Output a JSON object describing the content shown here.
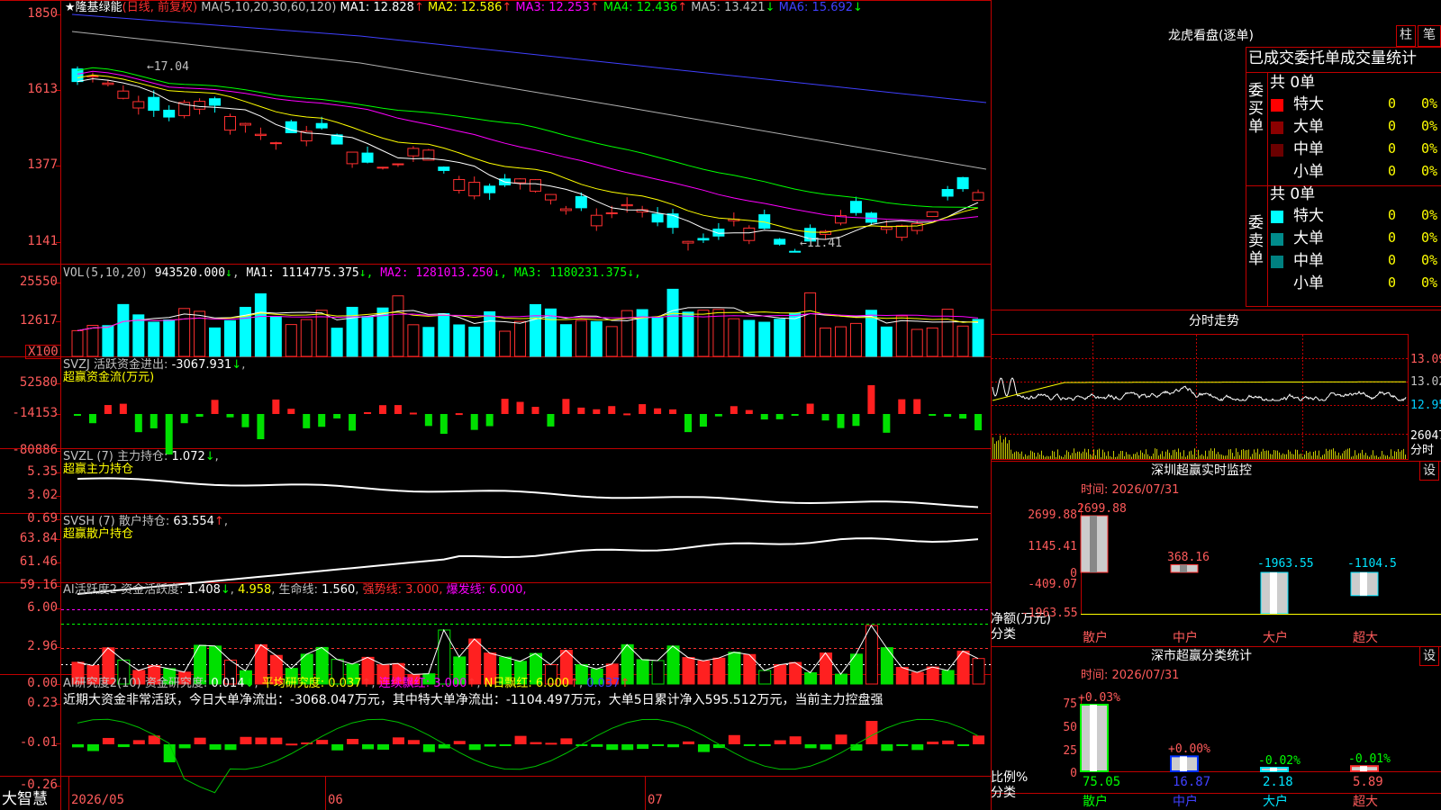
{
  "app_name": "大智慧",
  "main": {
    "star": "★",
    "stock_name": "隆基绿能",
    "period": "(日线, 前复权)",
    "ma_label": "MA(5,10,20,30,60,120)",
    "ma": [
      {
        "name": "MA1",
        "value": "12.828",
        "arrow": "↑",
        "color": "#ffffff"
      },
      {
        "name": "MA2",
        "value": "12.586",
        "arrow": "↑",
        "color": "#ffff00"
      },
      {
        "name": "MA3",
        "value": "12.253",
        "arrow": "↑",
        "color": "#ff00ff"
      },
      {
        "name": "MA4",
        "value": "12.436",
        "arrow": "↑",
        "color": "#00ff00"
      },
      {
        "name": "MA5",
        "value": "13.421",
        "arrow": "↓",
        "color": "#c0c0c0"
      },
      {
        "name": "MA6",
        "value": "15.692",
        "arrow": "↓",
        "color": "#4040ff"
      }
    ],
    "y_ticks": [
      "1850",
      "1613",
      "1377",
      "1141"
    ],
    "high_note": "←17.04",
    "low_note": "←11.41"
  },
  "vol": {
    "label": "VOL(5,10,20)",
    "value": "943520.000",
    "ma": [
      {
        "name": "MA1",
        "value": "1114775.375",
        "arrow": "↓",
        "color": "#ffffff"
      },
      {
        "name": "MA2",
        "value": "1281013.250",
        "arrow": "↓",
        "color": "#ff00ff"
      },
      {
        "name": "MA3",
        "value": "1180231.375",
        "arrow": "↓",
        "color": "#00ff00"
      }
    ],
    "y_ticks": [
      "25550",
      "12617"
    ],
    "unit": "X100"
  },
  "svzj": {
    "label": "SVZJ",
    "title": "活跃资金进出",
    "value": "-3067.931",
    "arrow": "↓",
    "subtitle": "超赢资金流(万元)",
    "y_ticks": [
      "52580",
      "-14153",
      "-80886"
    ]
  },
  "svzl": {
    "label": "SVZL (7)",
    "title": "主力持仓",
    "value": "1.072",
    "arrow": "↓",
    "subtitle": "超赢主力持仓",
    "y_ticks": [
      "5.35",
      "3.02",
      "0.69"
    ]
  },
  "svsh": {
    "label": "SVSH (7)",
    "title": "散户持仓",
    "value": "63.554",
    "arrow": "↑",
    "subtitle": "超赢散户持仓",
    "y_ticks": [
      "63.84",
      "61.46",
      "59.16"
    ]
  },
  "ai1": {
    "label": "AI活跃度2",
    "title": "资金活跃度",
    "value": "1.408",
    "arrow": "↓",
    "value2": "4.958",
    "life_label": "生命线",
    "life_value": "1.560",
    "strong_label": "强势线",
    "strong_value": "3.000",
    "burst_label": "爆发线",
    "burst_value": "6.000",
    "y_ticks": [
      "6.00",
      "2.96",
      "0.00"
    ]
  },
  "ai2": {
    "label": "AI研究度2(10)",
    "title": "资金研究度",
    "value": "0.014",
    "arrow": "↓",
    "avg_label": "平均研究度",
    "avg_value": "0.037",
    "cont_label": "连续飘红",
    "cont_value": "3.000",
    "n_label": "N日飘红",
    "n_value": "6.000",
    "extra_value": "0.037",
    "comment": "近期大资金非常活跃，今日大单净流出：-3068.047万元，其中特大单净流出：-1104.497万元，大单5日累计净入595.512万元，当前主力控盘强",
    "y_ticks": [
      "0.23",
      "-0.01",
      "-0.26"
    ]
  },
  "x_axis": [
    "2026/05",
    "06",
    "07"
  ],
  "dragon": {
    "title": "龙虎看盘(逐单)",
    "btn1": "柱",
    "btn2": "笔",
    "subtitle": "已成交委托单成交量统计",
    "buy_label": "委买单",
    "sell_label": "委卖单",
    "buy_total": "共 0单",
    "sell_total": "共 0单",
    "rows": [
      "特大",
      "大单",
      "中单",
      "小单"
    ],
    "buy_colors": [
      "#ff0000",
      "#8b0000",
      "#6b0000",
      ""
    ],
    "sell_colors": [
      "#00ffff",
      "#008b8b",
      "#008080",
      ""
    ],
    "count": "0",
    "pct": "0%"
  },
  "intraday": {
    "title": "分时走势",
    "price_ticks": [
      "13.09",
      "13.02",
      "12.95"
    ],
    "vol_value": "26047",
    "vol_label": "分时"
  },
  "monitor": {
    "title": "深圳超赢实时监控",
    "set": "设",
    "time": "时间: 2026/07/31",
    "y_ticks": [
      "2699.88",
      "1145.41",
      "0",
      "-409.07",
      "-1963.55"
    ],
    "ylabel": "净额(万元)",
    "xlabel": "分类",
    "categories": [
      "散户",
      "中户",
      "大户",
      "超大"
    ],
    "values": [
      2699.88,
      368.16,
      -1963.55,
      -1104.5
    ],
    "value_labels": [
      "2699.88",
      "368.16",
      "-1963.55",
      "-1104.5"
    ]
  },
  "classify": {
    "title": "深市超赢分类统计",
    "set": "设",
    "time": "时间: 2026/07/31",
    "y_ticks": [
      "75",
      "50",
      "25",
      "0"
    ],
    "ylabel": "比例%",
    "xlabel": "分类",
    "categories": [
      "散户",
      "中户",
      "大户",
      "超大"
    ],
    "values": [
      75.05,
      16.87,
      2.18,
      5.89
    ],
    "value_labels": [
      "75.05",
      "16.87",
      "2.18",
      "5.89"
    ],
    "change_labels": [
      "+0.03%",
      "+0.00%",
      "-0.02%",
      "-0.01%"
    ]
  }
}
